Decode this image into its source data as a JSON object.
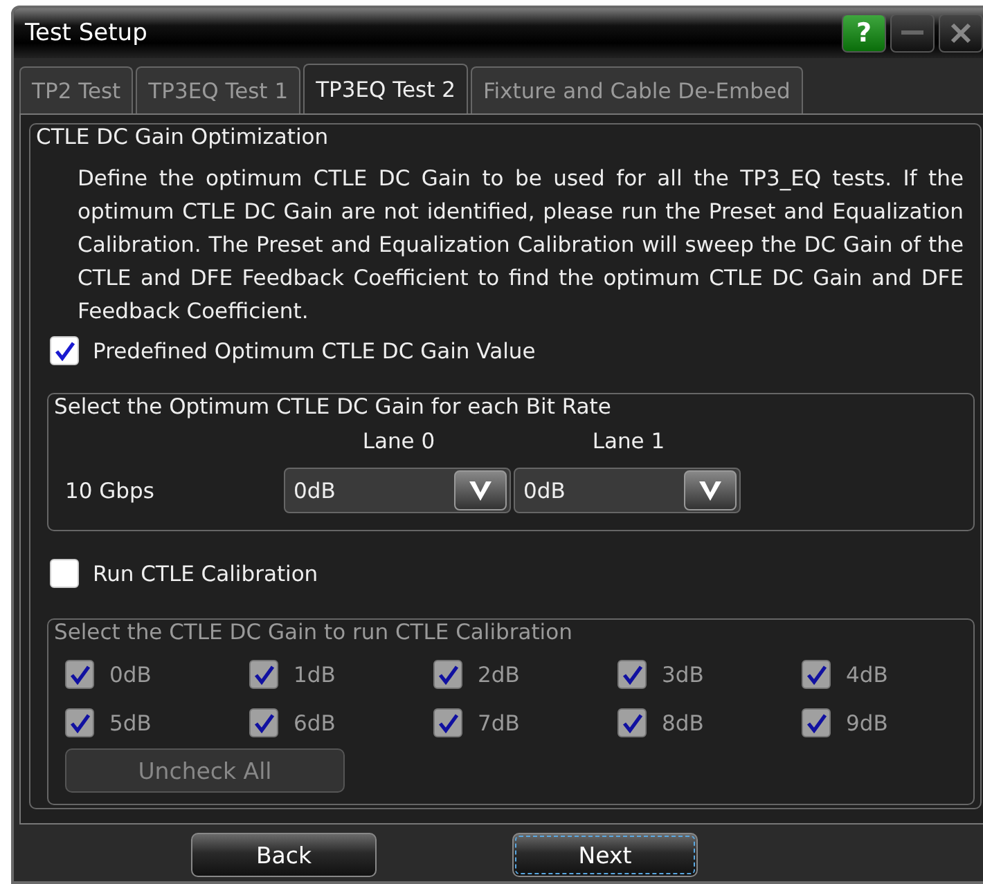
{
  "window": {
    "title": "Test Setup",
    "help": "?"
  },
  "tabs": [
    {
      "label": "TP2 Test",
      "selected": false
    },
    {
      "label": "TP3EQ Test 1",
      "selected": false
    },
    {
      "label": "TP3EQ Test 2",
      "selected": true
    },
    {
      "label": "Fixture and Cable De-Embed",
      "selected": false
    }
  ],
  "optimization": {
    "title": "CTLE DC Gain Optimization",
    "description": "Define the optimum CTLE DC Gain to be used for all the TP3_EQ tests. If the optimum CTLE DC Gain are not identified, please run the Preset and Equalization Calibration. The Preset and Equalization Calibration will sweep the DC Gain of the CTLE and DFE Feedback Coefficient to find the optimum CTLE DC Gain and DFE Feedback Coefficient.",
    "predefined": {
      "label": "Predefined Optimum CTLE DC Gain Value",
      "checked": true
    },
    "bit_rate": {
      "title": "Select the Optimum CTLE DC Gain for each Bit Rate",
      "columns": [
        "Lane 0",
        "Lane 1"
      ],
      "rows": [
        {
          "label": "10 Gbps",
          "values": [
            "0dB",
            "0dB"
          ]
        }
      ]
    },
    "run_calibration": {
      "label": "Run CTLE Calibration",
      "checked": false
    },
    "calibration": {
      "title": "Select the CTLE DC Gain to run CTLE Calibration",
      "disabled": true,
      "gains": [
        {
          "label": "0dB",
          "checked": true
        },
        {
          "label": "1dB",
          "checked": true
        },
        {
          "label": "2dB",
          "checked": true
        },
        {
          "label": "3dB",
          "checked": true
        },
        {
          "label": "4dB",
          "checked": true
        },
        {
          "label": "5dB",
          "checked": true
        },
        {
          "label": "6dB",
          "checked": true
        },
        {
          "label": "7dB",
          "checked": true
        },
        {
          "label": "8dB",
          "checked": true
        },
        {
          "label": "9dB",
          "checked": true
        }
      ],
      "uncheck_all": "Uncheck All"
    }
  },
  "footer": {
    "buttons": [
      {
        "label": "Back",
        "focused": false
      },
      {
        "label": "Next",
        "focused": true
      }
    ]
  }
}
